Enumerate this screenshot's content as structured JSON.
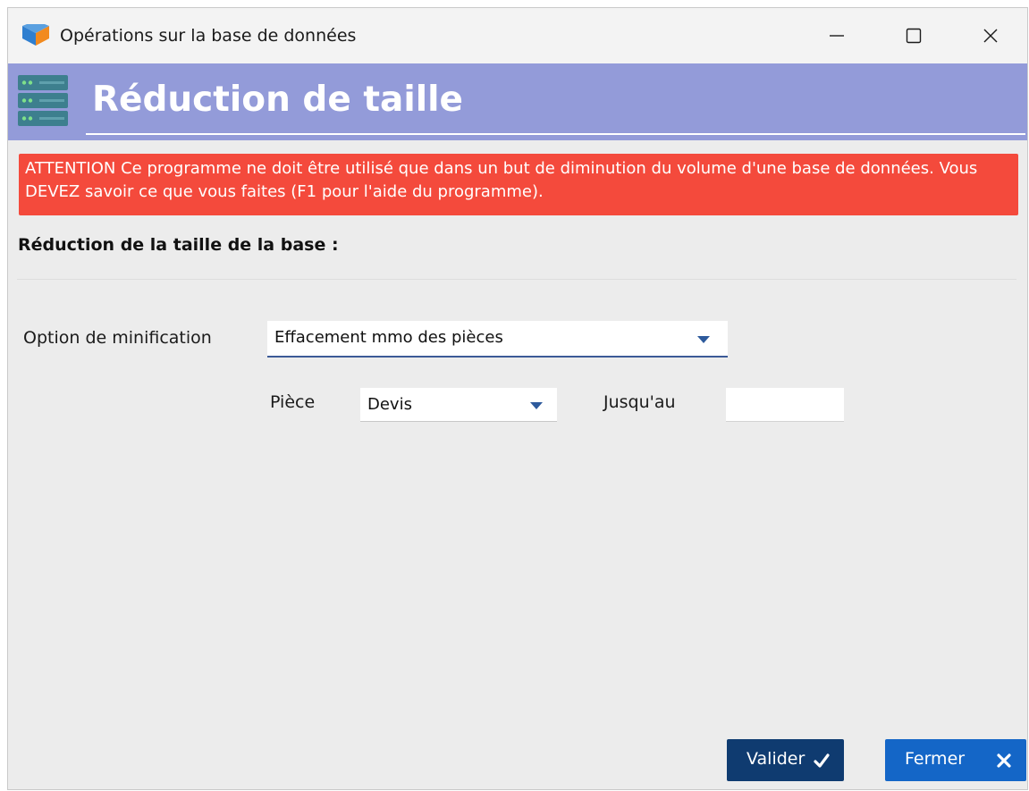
{
  "window": {
    "title": "Opérations sur la base de données",
    "controls": {
      "minimize": "minimize-icon",
      "maximize": "maximize-icon",
      "close": "close-icon"
    }
  },
  "header": {
    "title": "Réduction de taille",
    "icon": "database-server-icon",
    "background": "#939bd9"
  },
  "warning": {
    "text": "ATTENTION Ce programme ne doit être utilisé que dans un but de diminution du volume d'une base de données. Vous DEVEZ savoir ce que vous faites (F1 pour l'aide du programme).",
    "background": "#f44a3c"
  },
  "section": {
    "title": "Réduction de la taille de la base :"
  },
  "form": {
    "option_label": "Option de minification",
    "option_value": "Effacement mmo des pièces",
    "piece_label": "Pièce",
    "piece_value": "Devis",
    "until_label": "Jusqu'au",
    "until_value": ""
  },
  "buttons": {
    "validate_label": "Valider",
    "validate_icon": "checkmark-icon",
    "close_label": "Fermer",
    "close_icon": "close-icon"
  },
  "colors": {
    "accent_dark": "#0f3b70",
    "accent": "#1466c7"
  }
}
